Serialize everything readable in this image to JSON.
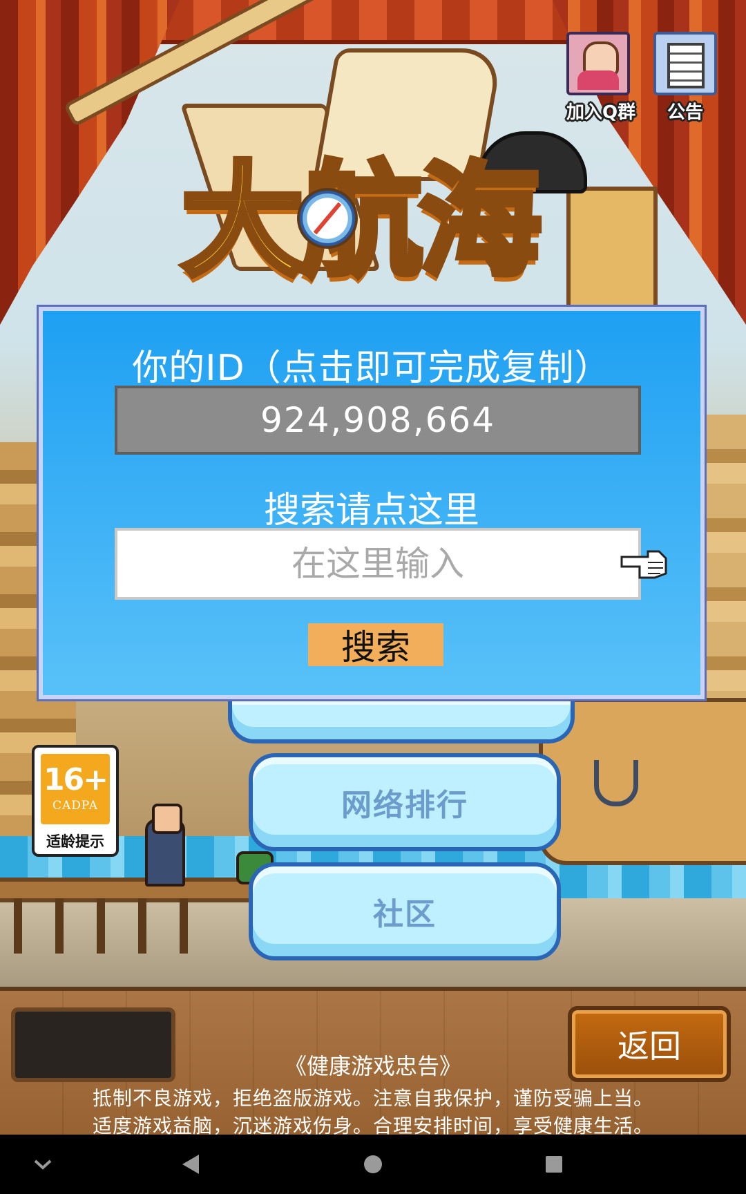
{
  "top_icons": {
    "qq_group": {
      "label": "加入Q群",
      "icon": "qq-group-avatar-icon"
    },
    "notice": {
      "label": "公告",
      "icon": "notice-document-icon"
    }
  },
  "logo": {
    "title": "大航海"
  },
  "dialog": {
    "title": "你的ID（点击即可完成复制）",
    "id_value": "924,908,664",
    "search_title": "搜索请点这里",
    "search_placeholder": "在这里输入",
    "search_button": "搜索",
    "pointer_icon": "pointing-hand-icon"
  },
  "menu": {
    "ranking": "网络排行",
    "community": "社区"
  },
  "age_rating": {
    "rating": "16+",
    "org": "CADPA",
    "tip": "适龄提示"
  },
  "bottom": {
    "back_button": "返回",
    "health_title": "《健康游戏忠告》",
    "health_line1": "抵制不良游戏，拒绝盗版游戏。注意自我保护，谨防受骗上当。",
    "health_line2": "适度游戏益脑，沉迷游戏伤身。合理安排时间，享受健康生活。"
  },
  "nav_bar": {
    "icons": [
      "chevron-down-icon",
      "back-triangle-icon",
      "home-circle-icon",
      "recents-square-icon"
    ]
  },
  "colors": {
    "dialog_blue": "#1ea0f2",
    "id_box_gray": "#8c8c8c",
    "search_button_orange": "#f2ae5a",
    "back_button_brown": "#c46a10",
    "cloud_button": "#bff0ff"
  }
}
